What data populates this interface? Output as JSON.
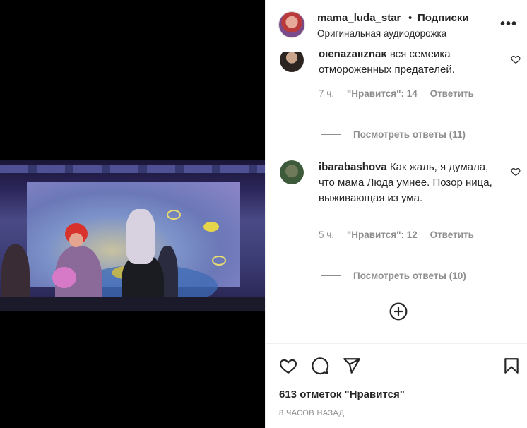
{
  "post": {
    "username": "mama_luda_star",
    "separator": "•",
    "follow_label": "Подписки",
    "audio_label": "Оригинальная аудиодорожка",
    "more_label": "•••"
  },
  "comments": [
    {
      "username": "olenazaliznak",
      "text": "вся семейка отмороженных предателей.",
      "time": "7 ч.",
      "likes": "\"Нравится\": 14",
      "reply_label": "Ответить",
      "view_replies": "Посмотреть ответы (11)"
    },
    {
      "username": "ibarabashova",
      "text": "Как жаль, я думала, что мама Люда умнее. Позор ница, выживающая из ума.",
      "time": "5 ч.",
      "likes": "\"Нравится\": 12",
      "reply_label": "Ответить",
      "view_replies": "Посмотреть ответы (10)"
    }
  ],
  "footer": {
    "likes_count": "613 отметок \"Нравится\"",
    "timestamp": "8 ЧАСОВ НАЗАД"
  },
  "icons": {
    "like": "heart-icon",
    "comment": "comment-icon",
    "share": "paper-plane-icon",
    "save": "bookmark-icon",
    "add_comment": "plus-circle-icon",
    "comment_like": "heart-icon"
  },
  "colors": {
    "text": "#262626",
    "secondary": "#8e8e8e",
    "divider": "#efefef",
    "media_bg": "#000000"
  }
}
